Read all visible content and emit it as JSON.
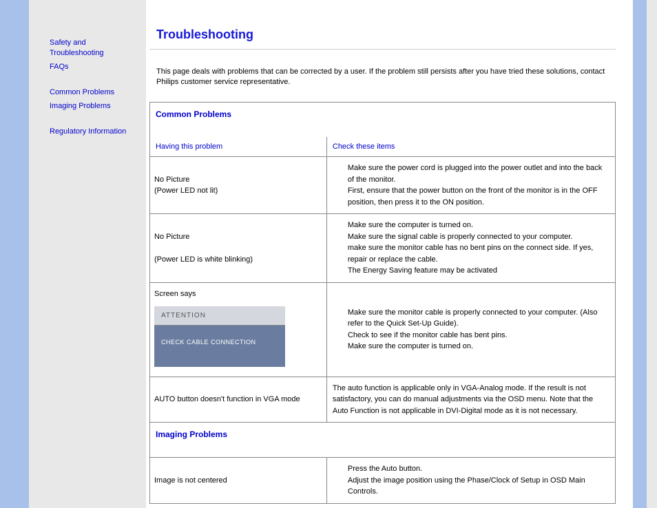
{
  "sidebar": {
    "safety": "Safety and Troubleshooting",
    "faqs": "FAQs",
    "common": "Common Problems",
    "imaging": "Imaging Problems",
    "regulatory": "Regulatory Information"
  },
  "main": {
    "title": "Troubleshooting",
    "intro": "This page deals with problems that can be corrected by a user. If the problem still persists after you have tried these solutions, contact Philips customer service representative."
  },
  "table": {
    "section_common": "Common Problems",
    "section_imaging": "Imaging Problems",
    "col_problem": "Having this problem",
    "col_check": "Check these items",
    "rows": [
      {
        "problem_l1": "No Picture",
        "problem_l2": "(Power LED not lit)",
        "check_l1": "Make sure the power cord is plugged into the power outlet and into the back of the monitor.",
        "check_l2": "First, ensure that the power button on the front of the monitor is in the OFF position, then press it to the ON position."
      },
      {
        "problem_l1": "No Picture",
        "problem_l2": "(Power LED is white blinking)",
        "check_l1": "Make sure the computer is turned on.",
        "check_l2": "Make sure the signal cable is properly connected to your computer.",
        "check_l3": "make sure the monitor cable has no bent pins on the connect side. If yes, repair or replace the cable.",
        "check_l4": "The Energy Saving feature may be activated"
      },
      {
        "problem_l1": "Screen says",
        "att_header": "ATTENTION",
        "att_body": "CHECK CABLE CONNECTION",
        "check_l1": "Make sure the monitor cable is properly connected to your computer. (Also refer to the Quick Set-Up Guide).",
        "check_l2": "Check to see if the monitor cable has bent pins.",
        "check_l3": "Make sure the computer is turned on."
      },
      {
        "problem_l1": "AUTO button doesn't function in VGA mode",
        "check_l1": "The auto function is applicable only in VGA-Analog mode.  If the result is not satisfactory, you can do manual adjustments via the OSD menu.  Note that the Auto Function is not applicable in DVI-Digital mode as it is not necessary."
      },
      {
        "problem_l1": "Image is not centered",
        "check_l1": "Press the Auto button.",
        "check_l2": "Adjust the image position using the Phase/Clock of Setup in OSD Main Controls."
      }
    ]
  }
}
